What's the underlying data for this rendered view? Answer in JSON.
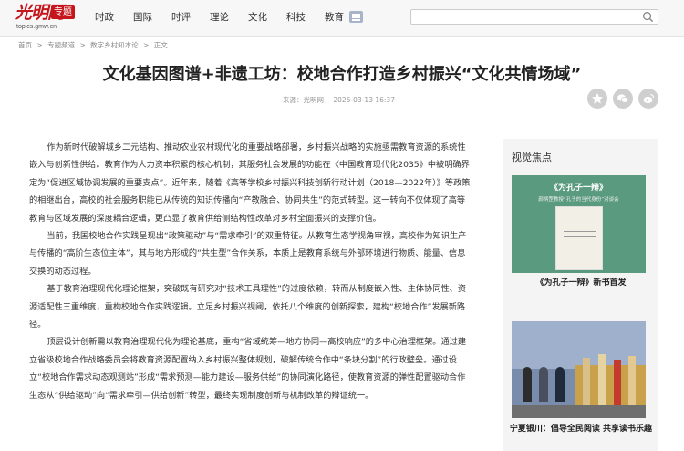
{
  "header": {
    "logo_text": "光明网",
    "logo_tag": "专题",
    "logo_domain": "topics.gmw.cn",
    "nav": [
      "时政",
      "国际",
      "时评",
      "理论",
      "文化",
      "科技",
      "教育"
    ]
  },
  "breadcrumb": [
    "首页",
    ">",
    "专题频道",
    ">",
    "数字乡村知本论",
    ">",
    "正文"
  ],
  "article": {
    "title": "文化基因图谱+非遗工坊：校地合作打造乡村振兴“文化共情场域”",
    "source": "来源：光明网",
    "date": "2025-03-13 16:37",
    "paragraphs": [
      "作为新时代破解城乡二元结构、推动农业农村现代化的重要战略部署，乡村振兴战略的实施亟需教育资源的系统性嵌入与创新性供给。教育作为人力资本积累的核心机制，其服务社会发展的功能在《中国教育现代化2035》中被明确界定为“促进区域协调发展的重要支点”。近年来，随着《高等学校乡村振兴科技创新行动计划（2018—2022年）》等政策的相继出台，高校的社会服务职能已从传统的知识传播向“产教融合、协同共生”的范式转型。这一转向不仅体现了高等教育与区域发展的深度耦合逻辑，更凸显了教育供给侧结构性改革对乡村全面振兴的支撑价值。",
      "当前，我国校地合作实践呈现出“政策驱动”与“需求牵引”的双重特征。从教育生态学视角审视，高校作为知识生产与传播的“高阶生态位主体”，其与地方形成的“共生型”合作关系，本质上是教育系统与外部环境进行物质、能量、信息交换的动态过程。",
      "基于教育治理现代化理论框架，突破既有研究对“技术工具理性”的过度依赖，转而从制度嵌入性、主体协同性、资源适配性三重维度，重构校地合作实践逻辑。立足乡村振兴视阈，依托八个维度的创新探索，建构“校地合作”发展新路径。",
      "顶层设计创新需以教育治理现代化为理论基底，重构“省域统筹—地方协同—高校响应”的多中心治理框架。通过建立省级校地合作战略委员会将教育资源配置纳入乡村振兴整体规划，破解传统合作中“条块分割”的行政壁垒。通过设立“校地合作需求动态观测站”形成“需求预测—能力建设—服务供给”的协同演化路径，使教育资源的弹性配置驱动合作生态从“供给驱动”向“需求牵引—供给创新”转型，最终实现制度创新与机制改革的辩证统一。"
    ]
  },
  "sidebar": {
    "title": "视觉焦点",
    "items": [
      {
        "caption": "《为孔子一辩》新书首发",
        "banner": "《为孔子一辩》",
        "banner_sub": "颜炳罡教授“孔子的当代身份”对谈会"
      },
      {
        "caption": "宁夏银川：倡导全民阅读 共享读书乐趣"
      }
    ]
  },
  "colors": {
    "brand_red": "#c4161c",
    "topbar_bg": "#f7f7f7",
    "share_gray": "#cfcfcf"
  }
}
